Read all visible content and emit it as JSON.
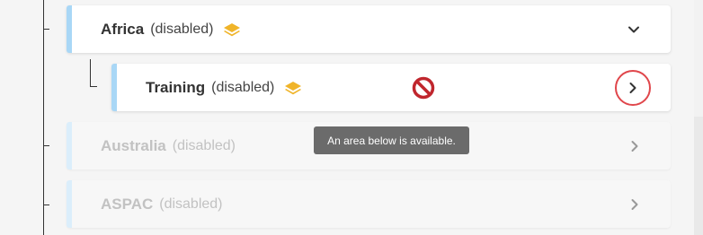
{
  "tree": {
    "items": [
      {
        "title": "Africa",
        "status": "(disabled)",
        "icon": "layers-icon",
        "expand_icon": "chevron-down-icon",
        "state": "expanded"
      },
      {
        "title": "Training",
        "status": "(disabled)",
        "icon": "layers-icon",
        "expand_icon": "chevron-right-icon",
        "state": "collapsed",
        "cursor_icon": "not-allowed-icon"
      },
      {
        "title": "Australia",
        "status": "(disabled)",
        "expand_icon": "chevron-right-icon",
        "state": "faded"
      },
      {
        "title": "ASPAC",
        "status": "(disabled)",
        "expand_icon": "chevron-right-icon",
        "state": "faded"
      }
    ]
  },
  "tooltip": {
    "text": "An area below is available."
  },
  "colors": {
    "accent": "#a9d7f6",
    "layers_icon": "#f0b429",
    "highlight_ring": "#e0464b",
    "not_allowed": "#c0262d"
  }
}
